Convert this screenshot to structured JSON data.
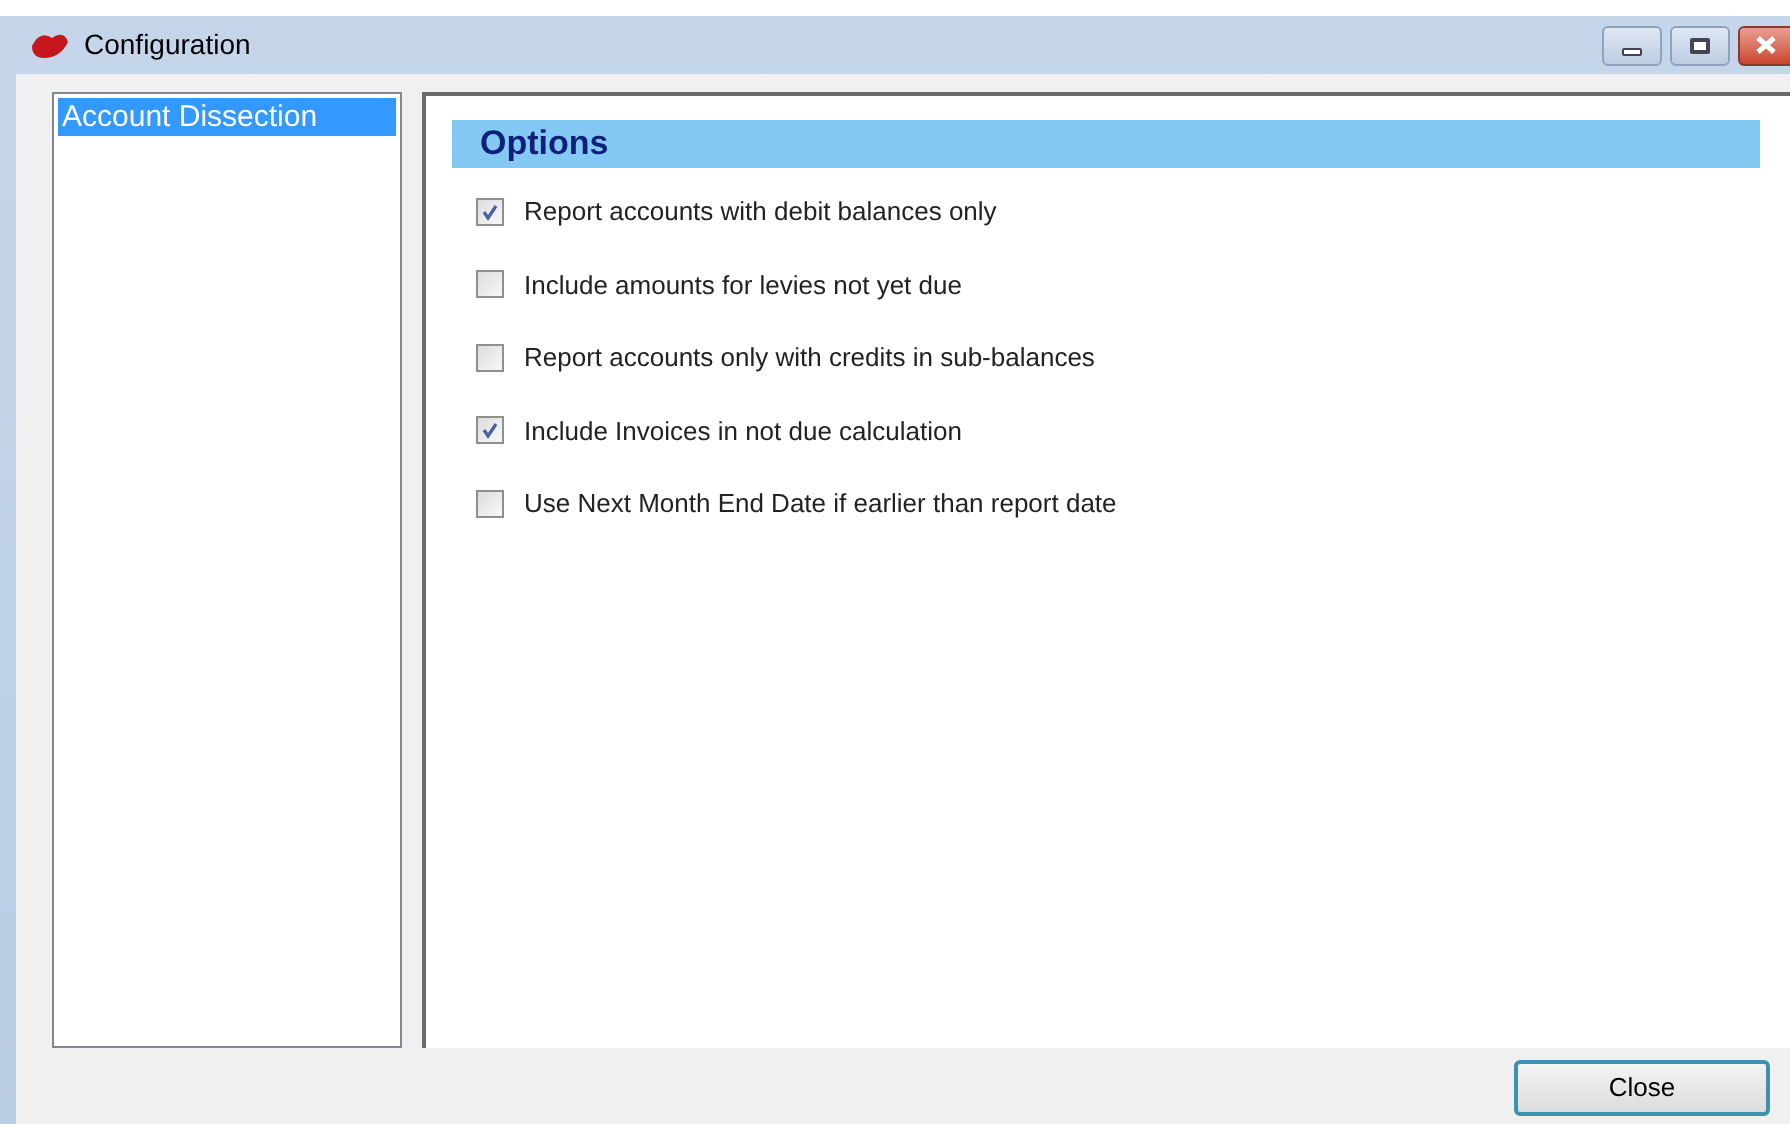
{
  "window": {
    "title": "Configuration"
  },
  "sidebar": {
    "items": [
      {
        "label": "Account Dissection",
        "selected": true
      }
    ]
  },
  "options": {
    "title": "Options",
    "items": [
      {
        "label": "Report accounts with debit balances only",
        "checked": true
      },
      {
        "label": "Include amounts for levies not yet due",
        "checked": false
      },
      {
        "label": "Report accounts only with credits in sub-balances",
        "checked": false
      },
      {
        "label": "Include Invoices in not due calculation",
        "checked": true
      },
      {
        "label": "Use Next Month End Date if earlier than report date",
        "checked": false
      }
    ]
  },
  "buttons": [
    {
      "label": "Close"
    }
  ]
}
